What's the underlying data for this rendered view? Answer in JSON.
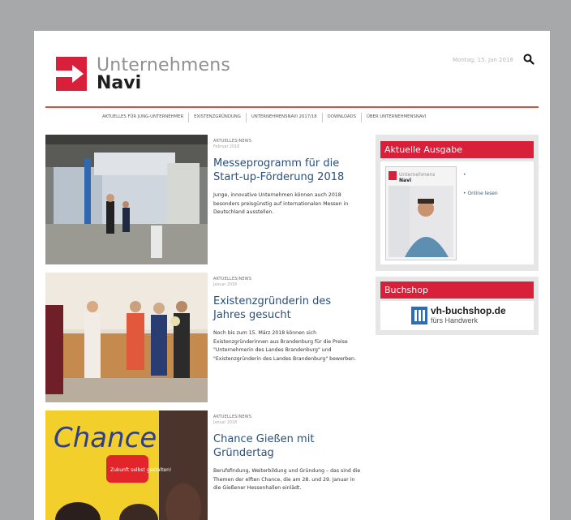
{
  "header": {
    "logo_top": "Unternehmens",
    "logo_bottom": "Navi",
    "date": "Montag, 15. Jan 2018"
  },
  "nav": {
    "items": [
      "AKTUELLES FÜR JUNG-UNTERNEHMER",
      "EXISTENZGRÜNDUNG",
      "UNTERNEHMENSNAVI 2017/18",
      "DOWNLOADS",
      "ÜBER UNTERNEHMENSNAVI"
    ]
  },
  "articles": [
    {
      "category": "AKTUELLES/NEWS",
      "date": "Februar 2018",
      "title": "Messeprogramm für die Start-up-Förderung 2018",
      "teaser": "Junge, innovative Unternehmen können auch 2018 besonders preisgünstig auf internationalen Messen in Deutschland ausstellen."
    },
    {
      "category": "AKTUELLES/NEWS",
      "date": "Januar 2018",
      "title": "Existenzgründerin des Jahres gesucht",
      "teaser": "Noch bis zum 15. März 2018 können sich Existenzgründerinnen aus Brandenburg für die Preise \"Unternehmerin des Landes Brandenburg\" und \"Existenzgründerin des Landes Brandenburg\" bewerben."
    },
    {
      "category": "AKTUELLES/NEWS",
      "date": "Januar 2018",
      "title": "Chance Gießen mit Gründertag",
      "teaser": "Berufsfindung, Weiterbildung und Gründung – das sind die Themen der elften Chance, die am 28. und 29. Januar in die Gießener Hessenhallen einlädt.",
      "poster_text": "Chance",
      "poster_badge": "Zukunft selbst gestalten!"
    }
  ],
  "sidebar": {
    "issue_title": "Aktuelle Ausgabe",
    "issue_bullet": "•",
    "issue_link": "• Online lesen",
    "cover_top": "Unternehmens",
    "cover_bottom": "Navi",
    "shop_title": "Buchshop",
    "shop_name": "vh-buchshop.de",
    "shop_sub": "fürs Handwerk"
  },
  "colors": {
    "accent_red": "#d8203a",
    "rule_red": "#e74a3b",
    "title_blue": "#2a4f7a",
    "frame_gray": "#a7a8aa"
  }
}
